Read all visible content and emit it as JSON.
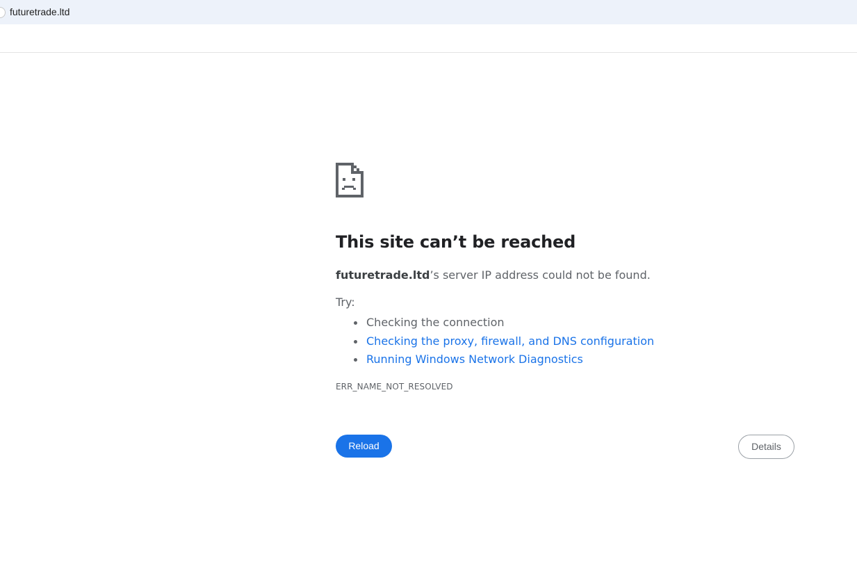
{
  "address_bar": {
    "url": "futuretrade.ltd"
  },
  "error_page": {
    "icon": "sad-page-icon",
    "title": "This site can’t be reached",
    "message_host": "futuretrade.ltd",
    "message_rest": "’s server IP address could not be found.",
    "try_label": "Try:",
    "suggestions": [
      {
        "label": "Checking the connection",
        "link": false
      },
      {
        "label": "Checking the proxy, firewall, and DNS configuration",
        "link": true
      },
      {
        "label": "Running Windows Network Diagnostics",
        "link": true
      }
    ],
    "error_code": "ERR_NAME_NOT_RESOLVED",
    "reload_label": "Reload",
    "details_label": "Details"
  },
  "colors": {
    "accent": "#1a73e8",
    "address_bar_bg": "#edf2fa",
    "text_secondary": "#5f6368",
    "title": "#202124"
  }
}
